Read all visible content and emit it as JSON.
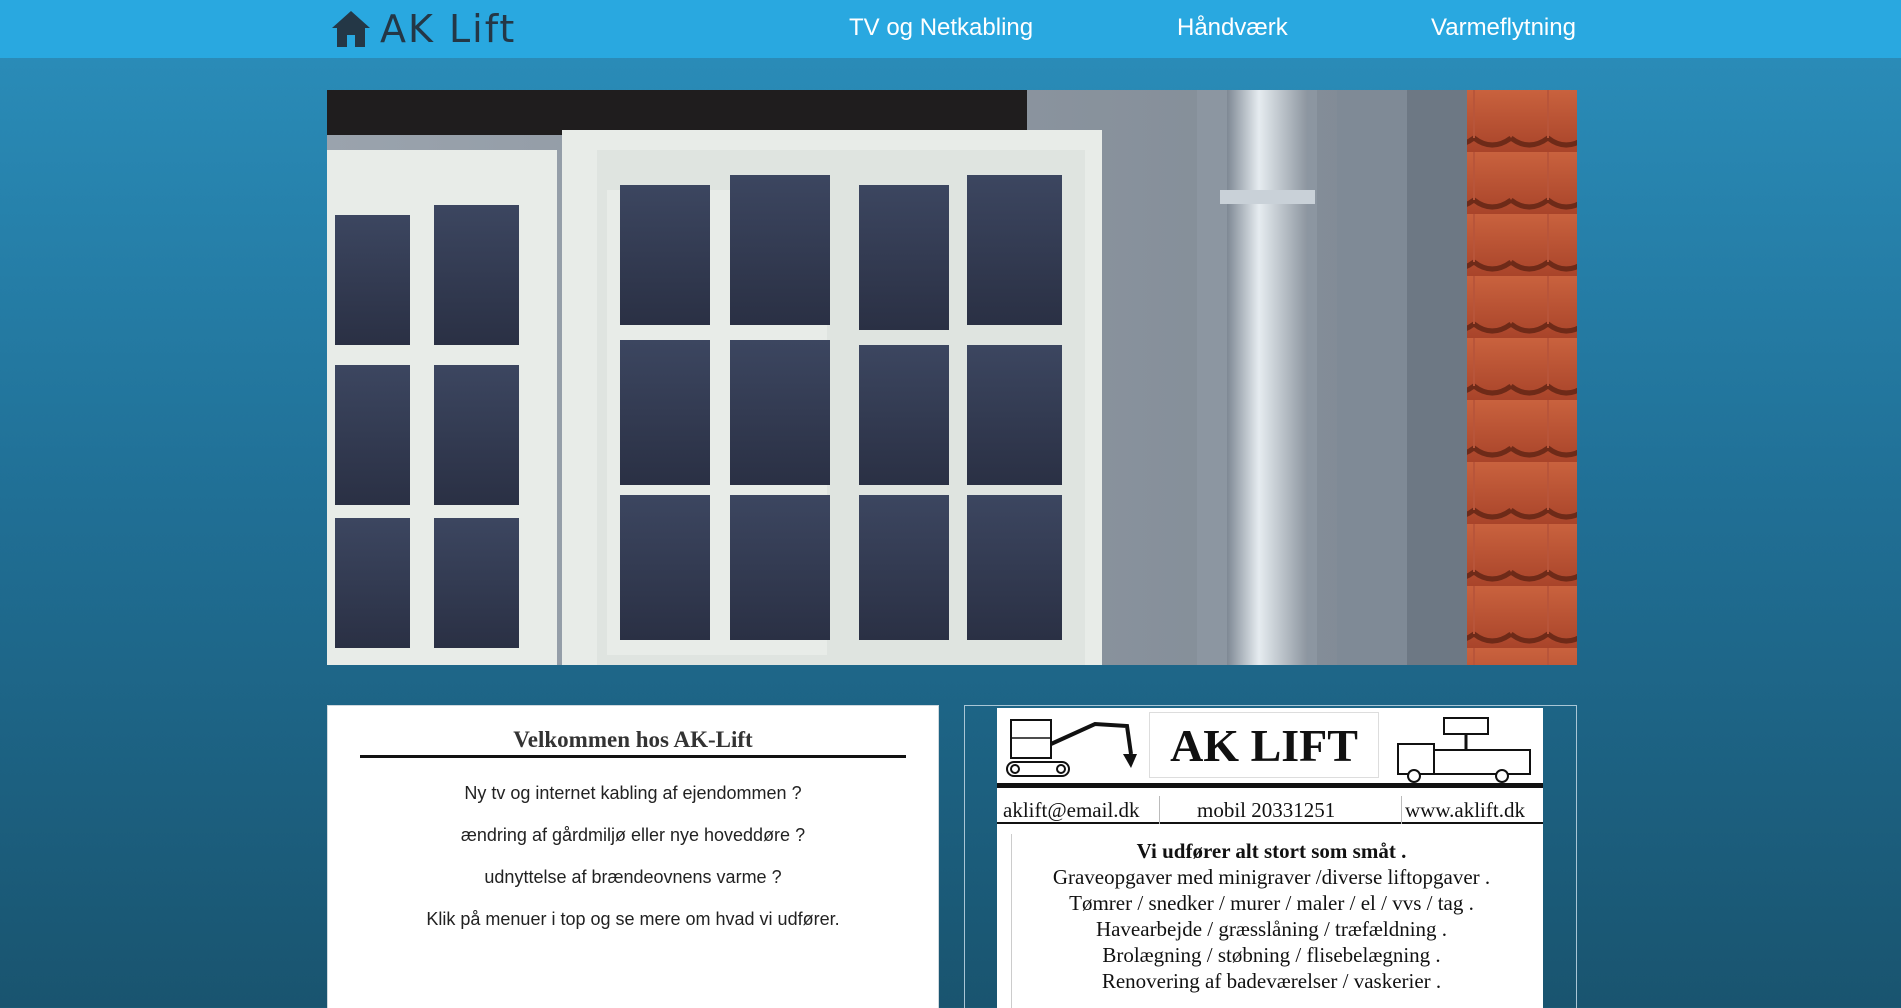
{
  "header": {
    "brand": "AK Lift",
    "brand_icon": "home-icon",
    "nav": [
      {
        "label": "TV og Netkabling"
      },
      {
        "label": "Håndværk"
      },
      {
        "label": "Varmeflytning"
      }
    ]
  },
  "welcome": {
    "title": "Velkommen hos AK-Lift",
    "lines": [
      "Ny tv og internet kabling af ejendommen ?",
      "ændring af gårdmiljø eller nye hoveddøre ?",
      "udnyttelse af brændeovnens varme ?",
      "Klik på menuer i top og se mere om hvad vi udfører."
    ]
  },
  "flyer": {
    "title": "AK LIFT",
    "email": "aklift@email.dk",
    "phone": "mobil 20331251",
    "web": "www.aklift.dk",
    "services": [
      "Vi udfører alt stort som småt .",
      "Graveopgaver med minigraver /diverse liftopgaver .",
      "Tømrer / snedker / murer / maler / el / vvs / tag .",
      "Havearbejde / græsslåning / træfældning .",
      "Brolægning / støbning / flisebelægning .",
      "Renovering af badeværelser / vaskerier ."
    ]
  },
  "colors": {
    "topbar": "#29a8e0",
    "brand_text": "#243746",
    "background_top": "#2b8fbc",
    "background_bottom": "#19546f"
  }
}
